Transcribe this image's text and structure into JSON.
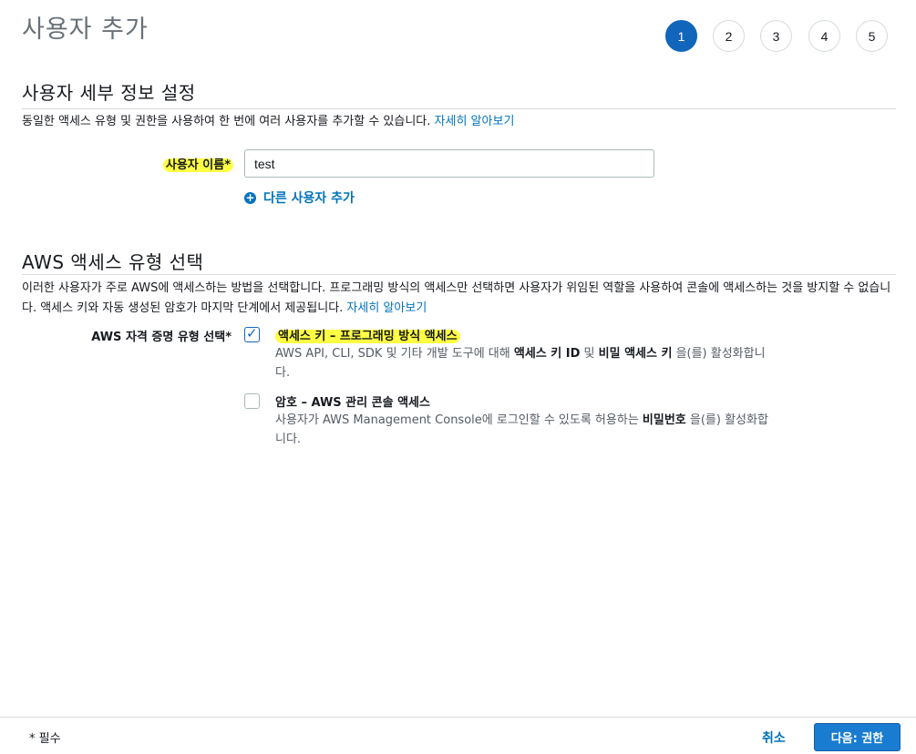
{
  "header": {
    "title": "사용자 추가",
    "steps": [
      "1",
      "2",
      "3",
      "4",
      "5"
    ]
  },
  "details": {
    "title": "사용자 세부 정보 설정",
    "description": "동일한 액세스 유형 및 권한을 사용하여 한 번에 여러 사용자를 추가할 수 있습니다. ",
    "learn_more": "자세히 알아보기",
    "username_label": "사용자 이름*",
    "username_value": "test",
    "add_user_label": "다른 사용자 추가"
  },
  "access": {
    "title": "AWS 액세스 유형 선택",
    "description": "이러한 사용자가 주로 AWS에 액세스하는 방법을 선택합니다. 프로그래밍 방식의 액세스만 선택하면 사용자가 위임된 역할을 사용하여 콘솔에 액세스하는 것을 방지할 수 없습니다. 액세스 키와 자동 생성된 암호가 마지막 단계에서 제공됩니다. ",
    "learn_more": "자세히 알아보기",
    "credential_label": "AWS 자격 증명 유형 선택*",
    "options": [
      {
        "title": "액세스 키 – 프로그래밍 방식 액세스",
        "checked": true,
        "desc_prefix": "AWS API, CLI, SDK 및 기타 개발 도구에 대해 ",
        "desc_bold1": "액세스 키 ID",
        "desc_mid": " 및 ",
        "desc_bold2": "비밀 액세스 키",
        "desc_suffix": " 을(를) 활성화합니다."
      },
      {
        "title": "암호 – AWS 관리 콘솔 액세스",
        "checked": false,
        "desc_prefix": "사용자가 AWS Management Console에 로그인할 수 있도록 허용하는 ",
        "desc_bold1": "비밀번호",
        "desc_suffix": " 을(를) 활성화합니다."
      }
    ]
  },
  "footer": {
    "required_note": "* 필수",
    "cancel_label": "취소",
    "next_label": "다음: 권한"
  },
  "colors": {
    "accent": "#1166bb",
    "link": "#0073bb",
    "highlight": "#ffff44"
  }
}
